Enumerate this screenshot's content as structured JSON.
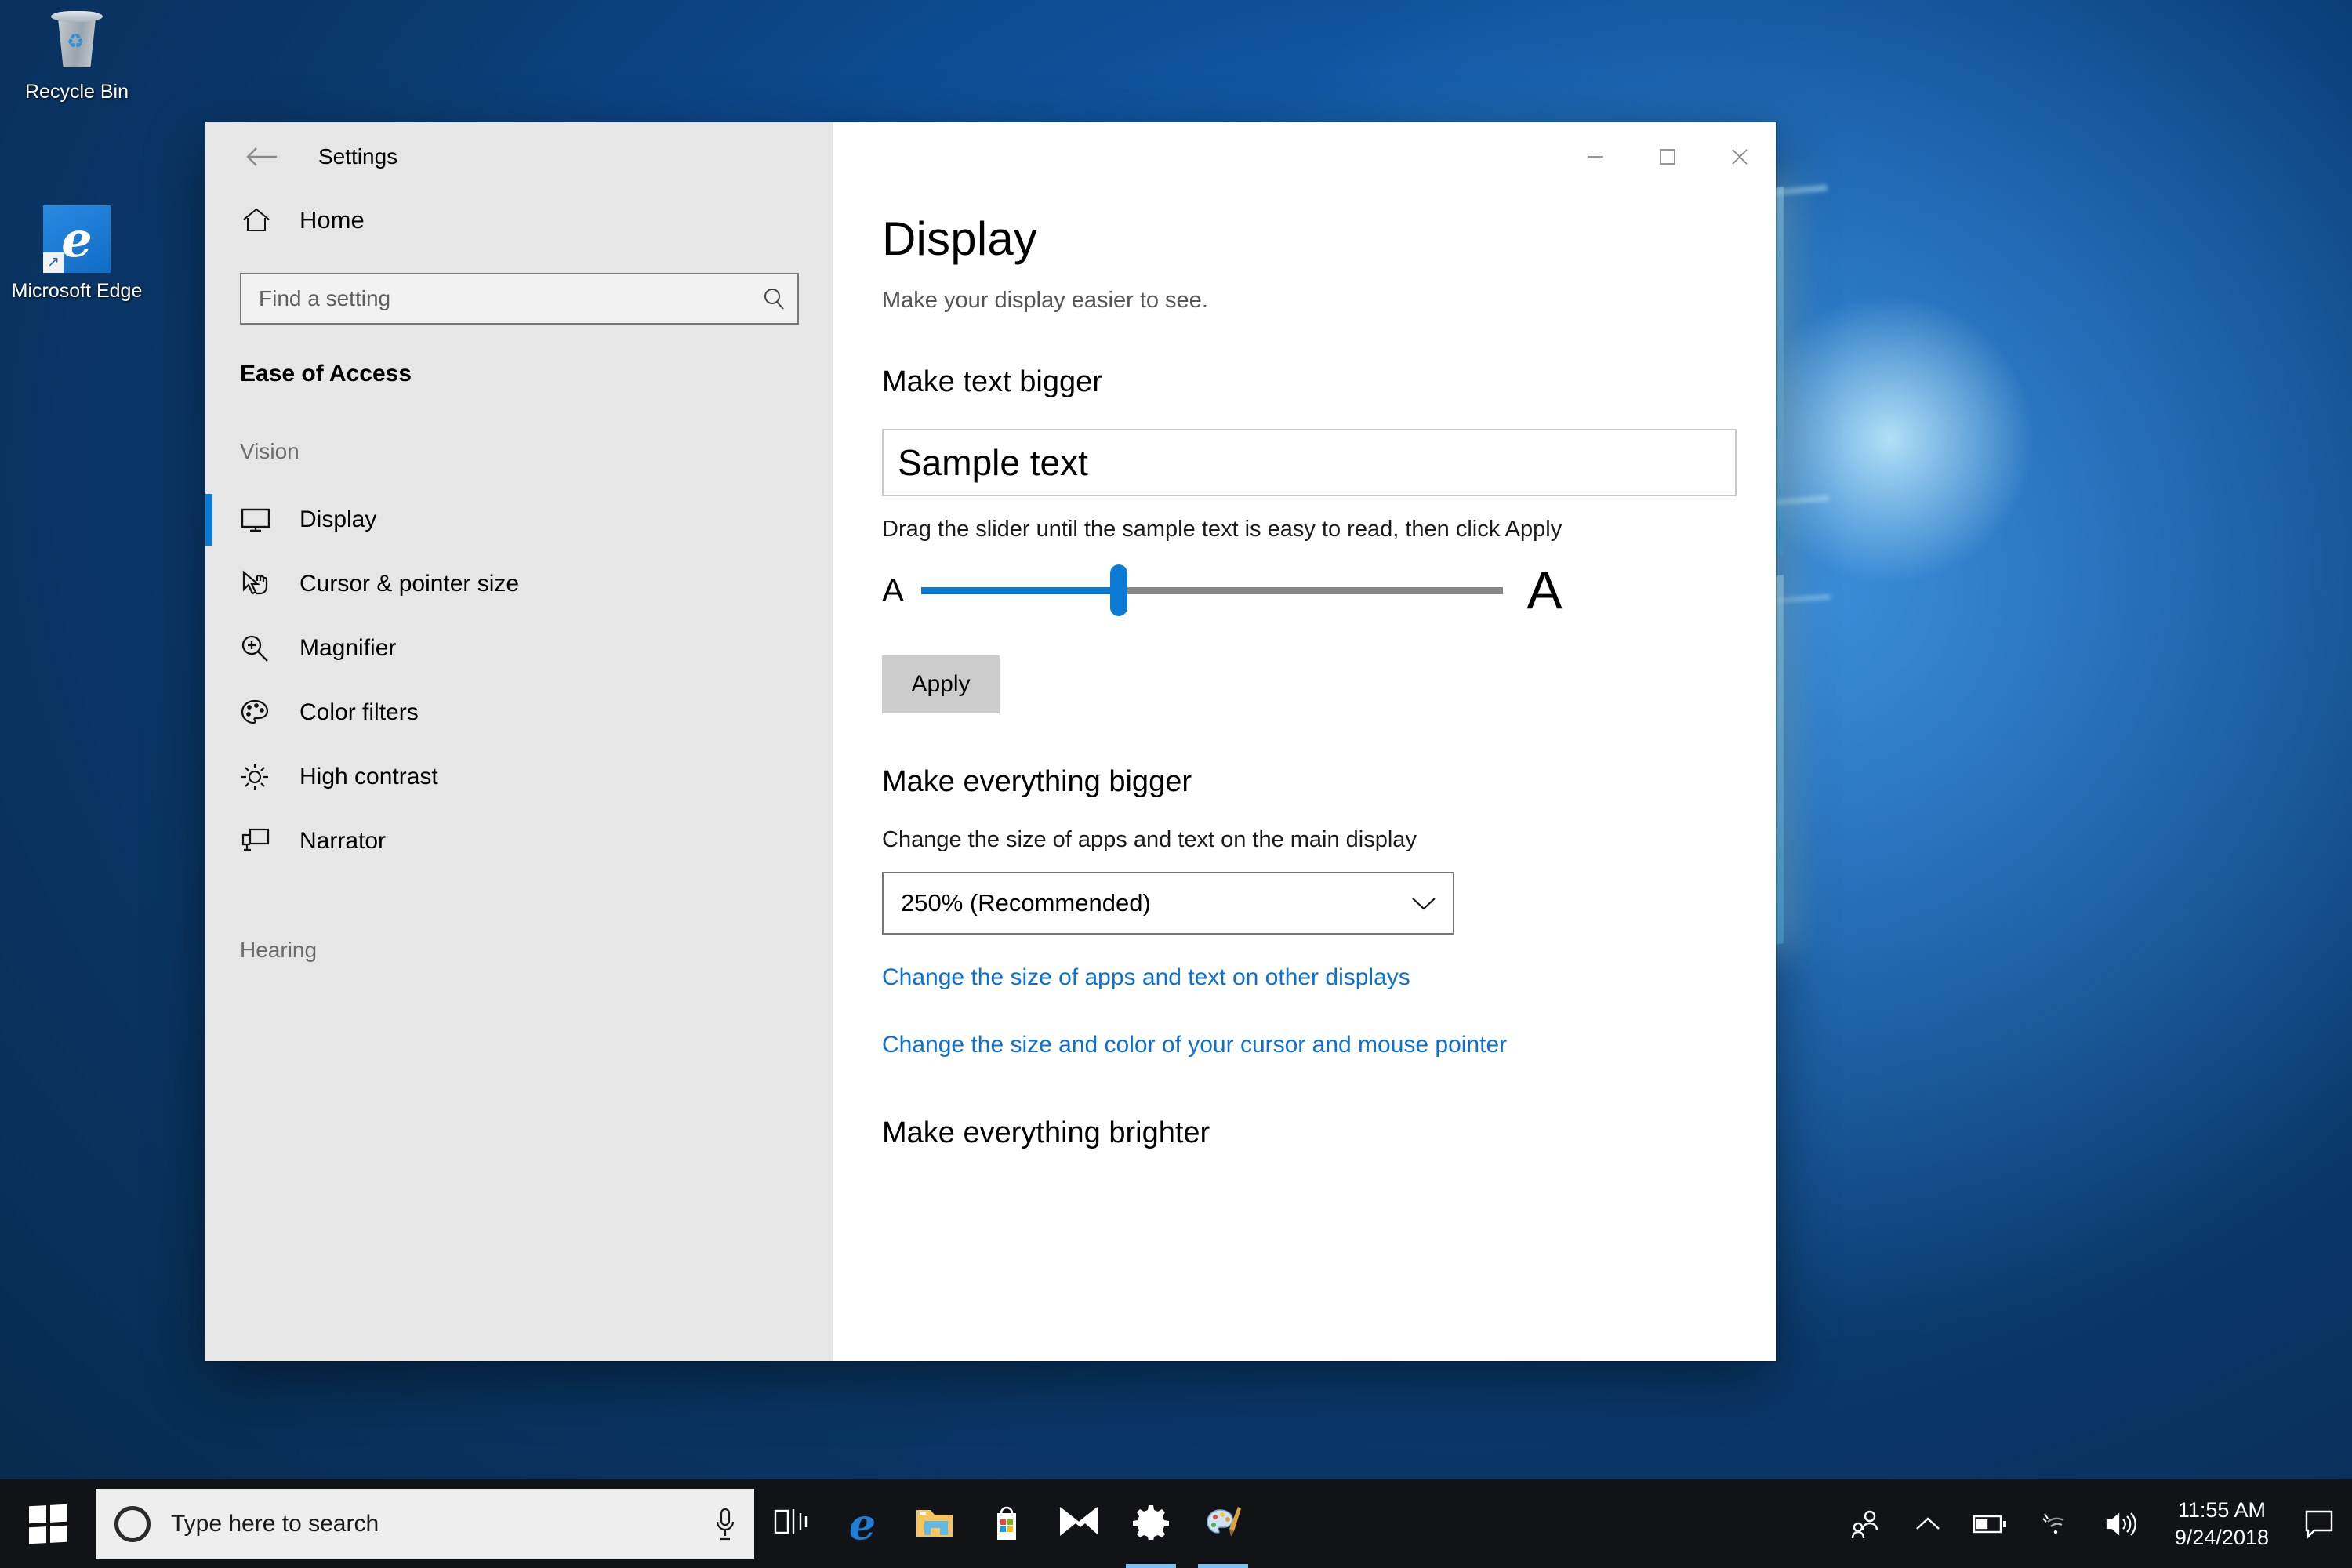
{
  "desktop": {
    "icons": [
      {
        "name": "Recycle Bin",
        "icon": "recycle-bin-icon"
      },
      {
        "name": "Microsoft Edge",
        "icon": "microsoft-edge-icon"
      }
    ]
  },
  "window": {
    "title": "Settings",
    "back_icon": "back-arrow-icon",
    "controls": {
      "minimize": "—",
      "maximize": "□",
      "close": "✕"
    }
  },
  "sidebar": {
    "home": {
      "label": "Home",
      "icon": "home-icon"
    },
    "search": {
      "placeholder": "Find a setting",
      "icon": "search-icon",
      "value": ""
    },
    "section_title": "Ease of Access",
    "groups": [
      {
        "label": "Vision",
        "items": [
          {
            "label": "Display",
            "icon": "monitor-icon",
            "selected": true
          },
          {
            "label": "Cursor & pointer size",
            "icon": "cursor-pointer-icon",
            "selected": false
          },
          {
            "label": "Magnifier",
            "icon": "magnifier-icon",
            "selected": false
          },
          {
            "label": "Color filters",
            "icon": "color-palette-icon",
            "selected": false
          },
          {
            "label": "High contrast",
            "icon": "brightness-icon",
            "selected": false
          },
          {
            "label": "Narrator",
            "icon": "narrator-icon",
            "selected": false
          }
        ]
      },
      {
        "label": "Hearing",
        "items": []
      }
    ]
  },
  "content": {
    "page_title": "Display",
    "page_subtitle": "Make your display easier to see.",
    "make_text_bigger": {
      "heading": "Make text bigger",
      "sample_text": "Sample text",
      "help_text": "Drag the slider until the sample text is easy to read, then click Apply",
      "slider": {
        "min_label": "A",
        "max_label": "A",
        "value_percent": 34,
        "fill_color": "#0b7ad4",
        "track_color": "#868686"
      },
      "apply_label": "Apply"
    },
    "make_everything_bigger": {
      "heading": "Make everything bigger",
      "select_label": "Change the size of apps and text on the main display",
      "select_value": "250% (Recommended)",
      "chevron_icon": "chevron-down-icon",
      "links": [
        "Change the size of apps and text on other displays",
        "Change the size and color of your cursor and mouse pointer"
      ],
      "link_color": "#0b6fd4"
    },
    "make_everything_brighter": {
      "heading": "Make everything brighter"
    }
  },
  "taskbar": {
    "start": {
      "icon": "windows-start-icon"
    },
    "search": {
      "placeholder": "Type here to search",
      "cortana_icon": "cortana-circle-icon",
      "mic_icon": "microphone-icon"
    },
    "apps": [
      {
        "name": "Task View",
        "icon": "task-view-icon",
        "active": false
      },
      {
        "name": "Microsoft Edge",
        "icon": "microsoft-edge-icon",
        "active": false
      },
      {
        "name": "File Explorer",
        "icon": "file-explorer-icon",
        "active": false
      },
      {
        "name": "Microsoft Store",
        "icon": "microsoft-store-icon",
        "active": false
      },
      {
        "name": "Mail",
        "icon": "mail-icon",
        "active": false
      },
      {
        "name": "Settings",
        "icon": "gear-icon",
        "active": true
      },
      {
        "name": "Paint 3D",
        "icon": "paint-palette-icon",
        "active": true
      }
    ],
    "tray": [
      {
        "name": "People",
        "icon": "people-icon"
      },
      {
        "name": "Show hidden icons",
        "icon": "chevron-up-icon"
      },
      {
        "name": "Battery",
        "icon": "battery-icon"
      },
      {
        "name": "Network",
        "icon": "wifi-icon"
      },
      {
        "name": "Volume",
        "icon": "speaker-icon"
      }
    ],
    "clock": {
      "time": "11:55 AM",
      "date": "9/24/2018"
    },
    "action_center": {
      "icon": "action-center-icon"
    }
  }
}
